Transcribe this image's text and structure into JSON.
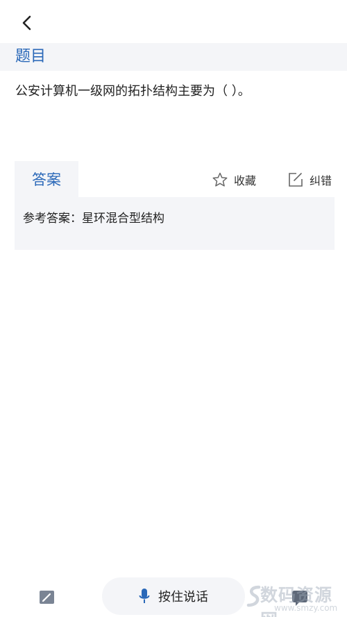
{
  "header": {
    "back_icon": "chevron-left-icon"
  },
  "section": {
    "title": "题目"
  },
  "question": {
    "text": "公安计算机一级网的拓扑结构主要为（ ）。"
  },
  "answer": {
    "tab_label": "答案",
    "favorite_label": "收藏",
    "favorite_icon": "star-outline-icon",
    "correction_label": "纠错",
    "correction_icon": "edit-square-icon",
    "answer_text": "参考答案：星环混合型结构"
  },
  "bottom_bar": {
    "left_icon": "note-edit-icon",
    "voice_label": "按住说话",
    "voice_icon": "microphone-icon",
    "right_icon": "chat-icon"
  },
  "watermark": {
    "text": "数码资源网",
    "url": "www.smzy.com"
  },
  "colors": {
    "accent": "#2a68b8",
    "panel": "#f4f5f8",
    "text": "#222222"
  }
}
